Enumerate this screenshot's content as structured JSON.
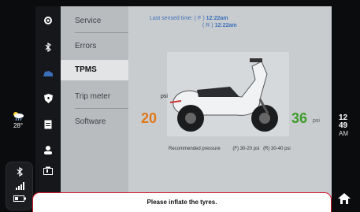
{
  "sidebar": {
    "items": [
      {
        "label": "Service",
        "icon": "gear-icon"
      },
      {
        "label": "Errors",
        "icon": "bluetooth-icon"
      },
      {
        "label": "TPMS",
        "icon": "tyre-icon",
        "active": true
      },
      {
        "label": "Trip meter",
        "icon": "shield-icon"
      },
      {
        "label": "Software",
        "icon": "document-icon"
      }
    ],
    "extra_icons": [
      "user-icon",
      "battery-level-icon"
    ]
  },
  "tpms": {
    "last_sensed_label": "Last sensed time:",
    "front_label": "( F )",
    "front_time": "12:22am",
    "rear_label": "( R )",
    "rear_time": "12:22am",
    "unit": "psi",
    "front_value": "20",
    "rear_value": "36",
    "rear_unit": "psi",
    "recommended_label": "Recommended pressure",
    "recommended_front": "(F) 30-20 psi",
    "recommended_rear": "(R) 30-40 psi"
  },
  "alert": {
    "message": "Please inflate the tyres."
  },
  "weather": {
    "temp": "28°",
    "icon": "cloud-rain-icon"
  },
  "status": {
    "bluetooth_icon": "bluetooth-icon",
    "signal_icon": "signal-icon",
    "battery_icon": "battery-icon"
  },
  "clock": {
    "hour": "12",
    "minute": "49",
    "meridiem": "AM"
  },
  "colors": {
    "front_value": "#e07818",
    "rear_value": "#3e9b2b",
    "accent": "#3a6fb8",
    "alert_border": "#d01b2c"
  }
}
